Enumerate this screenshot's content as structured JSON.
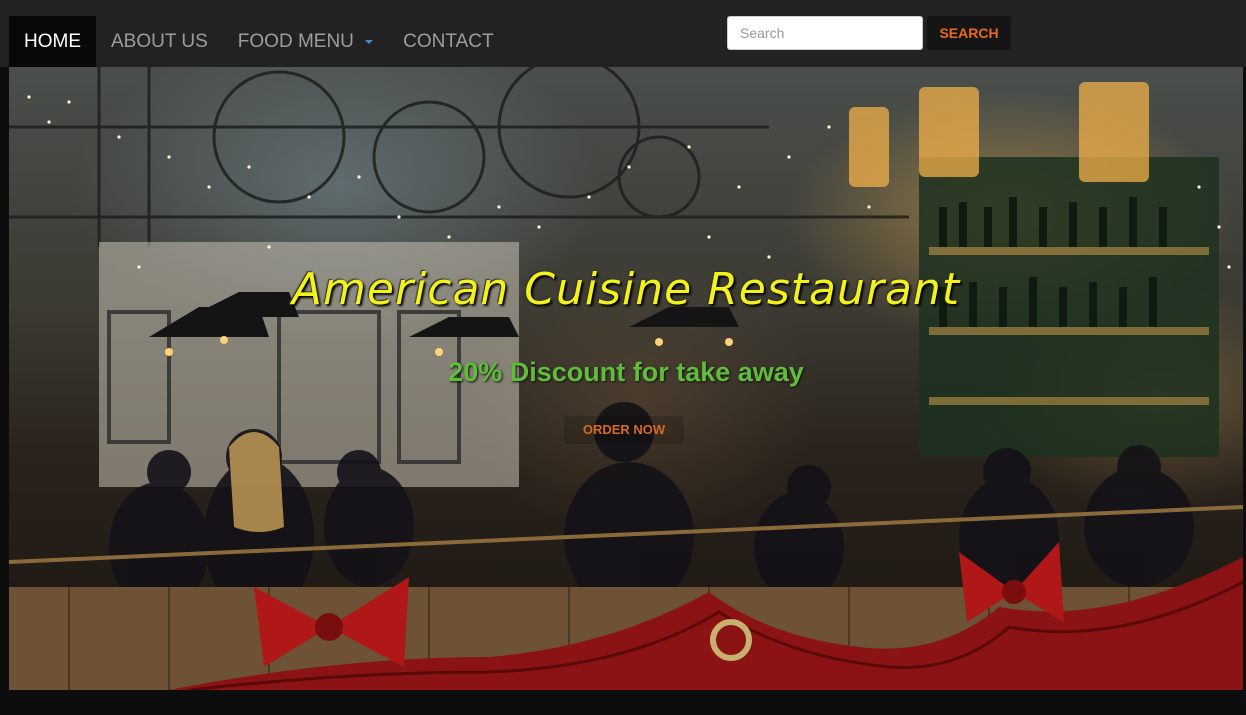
{
  "navbar": {
    "items": [
      {
        "label": "HOME",
        "active": true
      },
      {
        "label": "ABOUT US",
        "active": false
      },
      {
        "label": "FOOD MENU",
        "active": false,
        "dropdown": true
      },
      {
        "label": "CONTACT",
        "active": false
      }
    ],
    "search": {
      "placeholder": "Search",
      "button_label": "SEARCH"
    }
  },
  "hero": {
    "title": "American Cuisine Restaurant",
    "subtitle": "20% Discount for take away",
    "cta_label": "ORDER NOW",
    "image_description_icon": "restaurant-photo"
  },
  "colors": {
    "navbar_bg": "#222222",
    "active_bg": "#080808",
    "nav_text": "#9d9d9d",
    "title": "#f3f31a",
    "subtitle": "#5fbd3a",
    "accent_orange": "#e86a1e",
    "caret": "#3a8fd6"
  }
}
